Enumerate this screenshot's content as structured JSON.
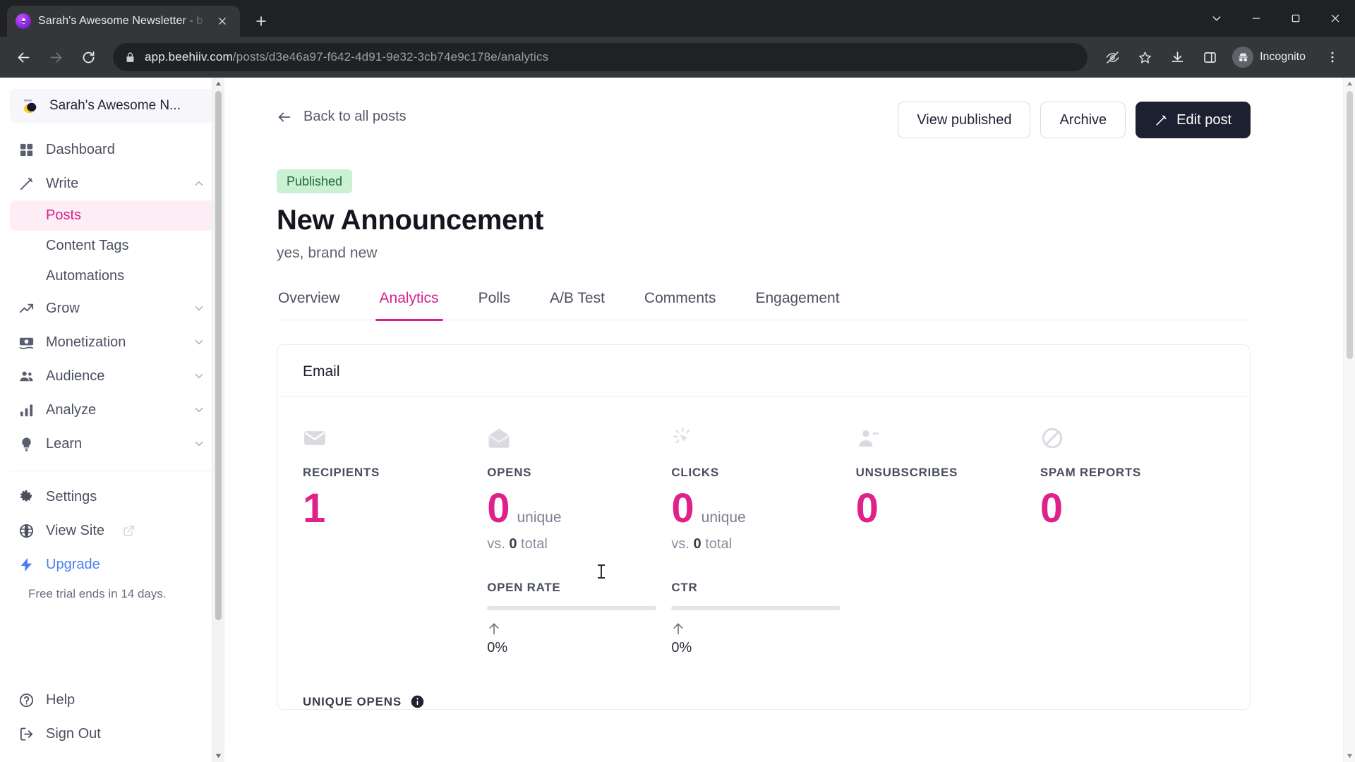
{
  "browser": {
    "tab": {
      "title": "Sarah's Awesome Newsletter - b",
      "favicon_icon": "beehiiv-bee-icon",
      "close_icon": "close-icon"
    },
    "new_tab_icon": "plus-icon",
    "window_controls": {
      "minimize_all_icon": "chevron-down-icon",
      "minimize_icon": "minimize-icon",
      "maximize_icon": "maximize-icon",
      "close_icon": "window-close-icon"
    },
    "nav": {
      "back_icon": "arrow-left-icon",
      "forward_icon": "arrow-right-icon",
      "reload_icon": "reload-icon"
    },
    "omnibox": {
      "lock_icon": "lock-icon",
      "url_host": "app.beehiiv.com",
      "url_path": "/posts/d3e46a97-f642-4d91-9e32-3cb74e9c178e/analytics"
    },
    "toolbar_icons": [
      {
        "name": "tracking-protection-icon",
        "glyph": "eye-off"
      },
      {
        "name": "bookmark-star-icon",
        "glyph": "star"
      },
      {
        "name": "downloads-icon",
        "glyph": "download"
      },
      {
        "name": "side-panel-icon",
        "glyph": "panel"
      }
    ],
    "profile": {
      "label": "Incognito",
      "avatar_icon": "incognito-hat-icon"
    },
    "menu_icon": "kebab-menu-icon"
  },
  "sidebar": {
    "brand": {
      "name": "Sarah's Awesome N...",
      "logo_icon": "beehiiv-logo-icon"
    },
    "items": [
      {
        "label": "Dashboard",
        "icon": "grid-icon",
        "expandable": false,
        "active": false
      },
      {
        "label": "Write",
        "icon": "pencil-icon",
        "expandable": true,
        "expanded": true,
        "chevron": "chevron-up-icon"
      },
      {
        "label": "Grow",
        "icon": "trending-up-icon",
        "expandable": true,
        "expanded": false,
        "chevron": "chevron-down-icon"
      },
      {
        "label": "Monetization",
        "icon": "money-icon",
        "expandable": true,
        "expanded": false,
        "chevron": "chevron-down-icon"
      },
      {
        "label": "Audience",
        "icon": "people-icon",
        "expandable": true,
        "expanded": false,
        "chevron": "chevron-down-icon"
      },
      {
        "label": "Analyze",
        "icon": "bar-chart-icon",
        "expandable": true,
        "expanded": false,
        "chevron": "chevron-down-icon"
      },
      {
        "label": "Learn",
        "icon": "lightbulb-icon",
        "expandable": true,
        "expanded": false,
        "chevron": "chevron-down-icon"
      }
    ],
    "write_subitems": [
      {
        "label": "Posts",
        "active": true
      },
      {
        "label": "Content Tags",
        "active": false
      },
      {
        "label": "Automations",
        "active": false
      }
    ],
    "footer_items": [
      {
        "label": "Settings",
        "icon": "gear-icon"
      },
      {
        "label": "View Site",
        "icon": "globe-icon",
        "external_icon": "external-link-icon"
      },
      {
        "label": "Upgrade",
        "icon": "lightning-bolt-icon",
        "accent": true
      }
    ],
    "trial_note": "Free trial ends in 14 days.",
    "bottom_items": [
      {
        "label": "Help",
        "icon": "help-circle-icon"
      },
      {
        "label": "Sign Out",
        "icon": "sign-out-icon"
      }
    ]
  },
  "main": {
    "back_link": "Back to all posts",
    "back_icon": "arrow-left-icon",
    "actions": {
      "view_published": "View published",
      "archive": "Archive",
      "edit_post": "Edit post",
      "edit_icon": "pencil-icon"
    },
    "status_badge": "Published",
    "title": "New Announcement",
    "subtitle": "yes, brand new",
    "tabs": [
      {
        "label": "Overview",
        "active": false
      },
      {
        "label": "Analytics",
        "active": true
      },
      {
        "label": "Polls",
        "active": false
      },
      {
        "label": "A/B Test",
        "active": false
      },
      {
        "label": "Comments",
        "active": false
      },
      {
        "label": "Engagement",
        "active": false
      }
    ],
    "card": {
      "title": "Email",
      "metrics": [
        {
          "label": "RECIPIENTS",
          "icon": "envelope-closed-icon",
          "value": "1",
          "unit": "",
          "sub_prefix": "",
          "sub_value": "",
          "sub_suffix": ""
        },
        {
          "label": "OPENS",
          "icon": "envelope-open-icon",
          "value": "0",
          "unit": "unique",
          "sub_prefix": "vs. ",
          "sub_value": "0",
          "sub_suffix": " total",
          "rate": {
            "label": "OPEN RATE",
            "percent": "0%",
            "arrow_icon": "arrow-up-icon",
            "bar_fill": 0
          }
        },
        {
          "label": "CLICKS",
          "icon": "cursor-click-icon",
          "value": "0",
          "unit": "unique",
          "sub_prefix": "vs. ",
          "sub_value": "0",
          "sub_suffix": " total",
          "rate": {
            "label": "CTR",
            "percent": "0%",
            "arrow_icon": "arrow-up-icon",
            "bar_fill": 0
          }
        },
        {
          "label": "UNSUBSCRIBES",
          "icon": "person-minus-icon",
          "value": "0",
          "unit": "",
          "sub_prefix": "",
          "sub_value": "",
          "sub_suffix": ""
        },
        {
          "label": "SPAM REPORTS",
          "icon": "no-entry-icon",
          "value": "0",
          "unit": "",
          "sub_prefix": "",
          "sub_value": "",
          "sub_suffix": ""
        }
      ],
      "unique_opens_label": "UNIQUE OPENS",
      "unique_opens_info_icon": "info-icon"
    }
  },
  "colors": {
    "accent_pink": "#e0218a",
    "badge_green_bg": "#ccf0d4",
    "badge_green_text": "#1f6b36",
    "upgrade_blue": "#4f7df3",
    "dark_button": "#1d2030"
  }
}
